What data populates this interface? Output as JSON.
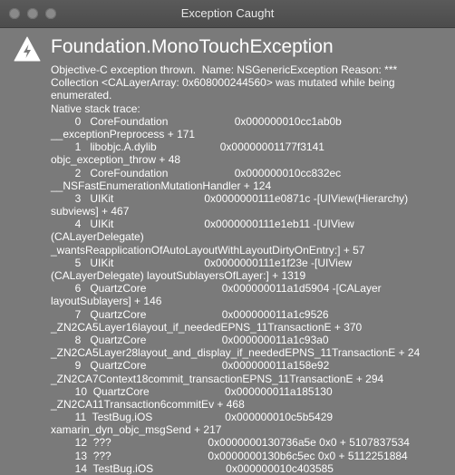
{
  "window": {
    "title": "Exception Caught",
    "heading": "Foundation.MonoTouchException"
  },
  "icons": {
    "warning": "warning-triangle-lightning-icon",
    "close": "window-close-icon",
    "minimize": "window-minimize-icon",
    "zoom": "window-zoom-icon"
  },
  "colors": {
    "background": "#7a7a7a",
    "titlebar": "#4f4f4f",
    "text": "#ffffff"
  },
  "message_lines": [
    "Objective-C exception thrown.  Name: NSGenericException Reason: ***",
    "Collection <CALayerArray: 0x608000244560> was mutated while being",
    "enumerated.",
    "Native stack trace:",
    "        0   CoreFoundation                      0x000000010cc1ab0b",
    "__exceptionPreprocess + 171",
    "        1   libobjc.A.dylib                     0x00000001177f3141",
    "objc_exception_throw + 48",
    "        2   CoreFoundation                      0x000000010cc832ec",
    "__NSFastEnumerationMutationHandler + 124",
    "        3   UIKit                              0x0000000111e0871c -[UIView(Hierarchy)",
    "subviews] + 467",
    "        4   UIKit                              0x0000000111e1eb11 -[UIView",
    "(CALayerDelegate)",
    "_wantsReapplicationOfAutoLayoutWithLayoutDirtyOnEntry:] + 57",
    "        5   UIKit                              0x0000000111e1f23e -[UIView",
    "(CALayerDelegate) layoutSublayersOfLayer:] + 1319",
    "        6   QuartzCore                         0x000000011a1d5904 -[CALayer",
    "layoutSublayers] + 146",
    "        7   QuartzCore                         0x000000011a1c9526",
    "_ZN2CA5Layer16layout_if_neededEPNS_11TransactionE + 370",
    "        8   QuartzCore                         0x000000011a1c93a0",
    "_ZN2CA5Layer28layout_and_display_if_neededEPNS_11TransactionE + 24",
    "        9   QuartzCore                         0x000000011a158e92",
    "_ZN2CA7Context18commit_transactionEPNS_11TransactionE + 294",
    "        10  QuartzCore                         0x000000011a185130",
    "_ZN2CA11Transaction6commitEv + 468",
    "        11  TestBug.iOS                        0x000000010c5b5429",
    "xamarin_dyn_objc_msgSend + 217",
    "        12  ???                                0x0000000130736a5e 0x0 + 5107837534",
    "        13  ???                                0x0000000130b6c5ec 0x0 + 5112251884",
    "        14  TestBug.iOS                        0x000000010c403585"
  ]
}
